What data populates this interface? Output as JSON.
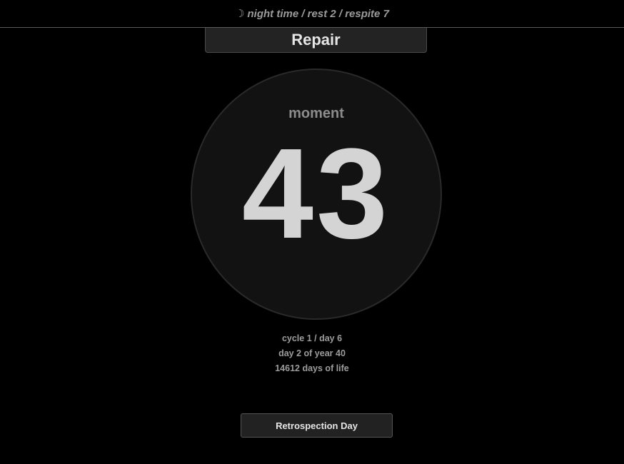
{
  "header": {
    "icon": "moon-icon",
    "moon_glyph": "☽",
    "status_text": "night time / rest 2 / respite 7"
  },
  "title": "Repair",
  "dial": {
    "label": "moment",
    "value": "43"
  },
  "info": {
    "cycle": "cycle 1 / day 6",
    "year": "day 2 of year 40",
    "life": "14612 days of life"
  },
  "action": {
    "label": "Retrospection Day"
  },
  "colors": {
    "background": "#000000",
    "panel": "#232323",
    "dial": "#121212",
    "text": "#d4d4d4",
    "muted": "#9a9a9a"
  }
}
